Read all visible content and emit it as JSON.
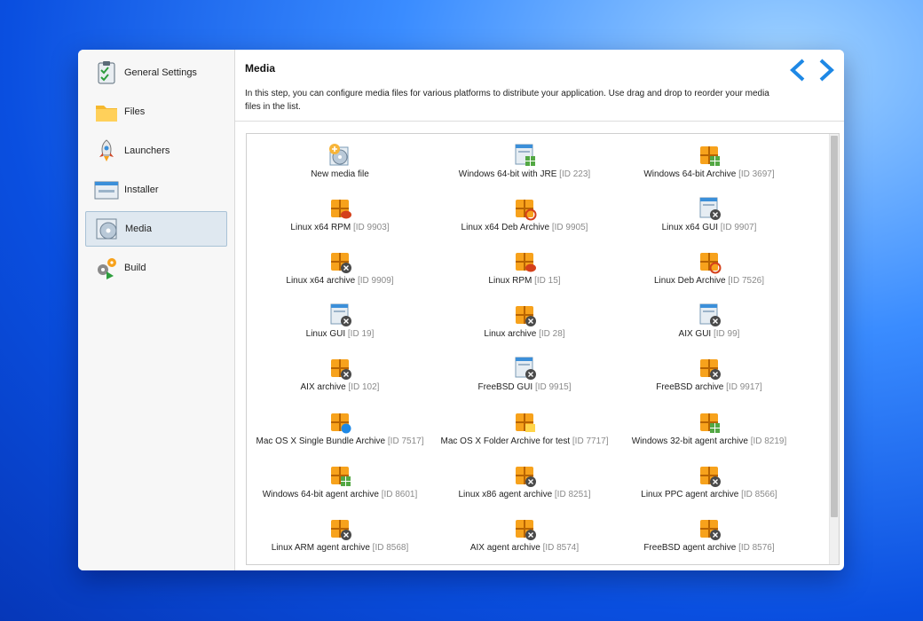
{
  "sidebar": {
    "items": [
      {
        "label": "General Settings",
        "icon": "clipboard-check-icon",
        "selected": false
      },
      {
        "label": "Files",
        "icon": "folder-icon",
        "selected": false
      },
      {
        "label": "Launchers",
        "icon": "rocket-icon",
        "selected": false
      },
      {
        "label": "Installer",
        "icon": "installer-window-icon",
        "selected": false
      },
      {
        "label": "Media",
        "icon": "media-disc-icon",
        "selected": true
      },
      {
        "label": "Build",
        "icon": "gears-build-icon",
        "selected": false
      }
    ]
  },
  "header": {
    "title": "Media",
    "description": "In this step, you can configure media files for various platforms to distribute your application. Use drag and drop to reorder your media files in the list.",
    "back_icon": "chevron-left-icon",
    "next_icon": "chevron-right-icon",
    "accent": "#1e88e5"
  },
  "media": [
    {
      "label": "New media file",
      "id": "",
      "icon": "new-media-icon"
    },
    {
      "label": "Windows 64-bit with JRE",
      "id": "[ID 223]",
      "icon": "windows-installer-icon"
    },
    {
      "label": "Windows 64-bit Archive",
      "id": "[ID 3697]",
      "icon": "windows-archive-icon"
    },
    {
      "label": "Linux x64 RPM",
      "id": "[ID 9903]",
      "icon": "rpm-archive-icon"
    },
    {
      "label": "Linux x64 Deb Archive",
      "id": "[ID 9905]",
      "icon": "deb-archive-icon"
    },
    {
      "label": "Linux x64 GUI",
      "id": "[ID 9907]",
      "icon": "unix-installer-icon"
    },
    {
      "label": "Linux x64 archive",
      "id": "[ID 9909]",
      "icon": "unix-archive-icon"
    },
    {
      "label": "Linux RPM",
      "id": "[ID 15]",
      "icon": "rpm-archive-icon"
    },
    {
      "label": "Linux Deb Archive",
      "id": "[ID 7526]",
      "icon": "deb-archive-icon"
    },
    {
      "label": "Linux GUI",
      "id": "[ID 19]",
      "icon": "unix-installer-icon"
    },
    {
      "label": "Linux archive",
      "id": "[ID 28]",
      "icon": "unix-archive-icon"
    },
    {
      "label": "AIX GUI",
      "id": "[ID 99]",
      "icon": "unix-installer-icon"
    },
    {
      "label": "AIX archive",
      "id": "[ID 102]",
      "icon": "unix-archive-icon"
    },
    {
      "label": "FreeBSD GUI",
      "id": "[ID 9915]",
      "icon": "unix-installer-icon"
    },
    {
      "label": "FreeBSD archive",
      "id": "[ID 9917]",
      "icon": "unix-archive-icon"
    },
    {
      "label": "Mac OS X Single Bundle Archive",
      "id": "[ID 7517]",
      "icon": "mac-bundle-archive-icon"
    },
    {
      "label": "Mac OS X Folder Archive for test",
      "id": "[ID 7717]",
      "icon": "mac-folder-archive-icon"
    },
    {
      "label": "Windows 32-bit agent archive",
      "id": "[ID 8219]",
      "icon": "windows-archive-icon"
    },
    {
      "label": "Windows 64-bit agent archive",
      "id": "[ID 8601]",
      "icon": "windows-archive-icon"
    },
    {
      "label": "Linux x86 agent archive",
      "id": "[ID 8251]",
      "icon": "unix-archive-icon"
    },
    {
      "label": "Linux PPC agent archive",
      "id": "[ID 8566]",
      "icon": "unix-archive-icon"
    },
    {
      "label": "Linux ARM agent archive",
      "id": "[ID 8568]",
      "icon": "unix-archive-icon"
    },
    {
      "label": "AIX agent archive",
      "id": "[ID 8574]",
      "icon": "unix-archive-icon"
    },
    {
      "label": "FreeBSD agent archive",
      "id": "[ID 8576]",
      "icon": "unix-archive-icon"
    }
  ]
}
